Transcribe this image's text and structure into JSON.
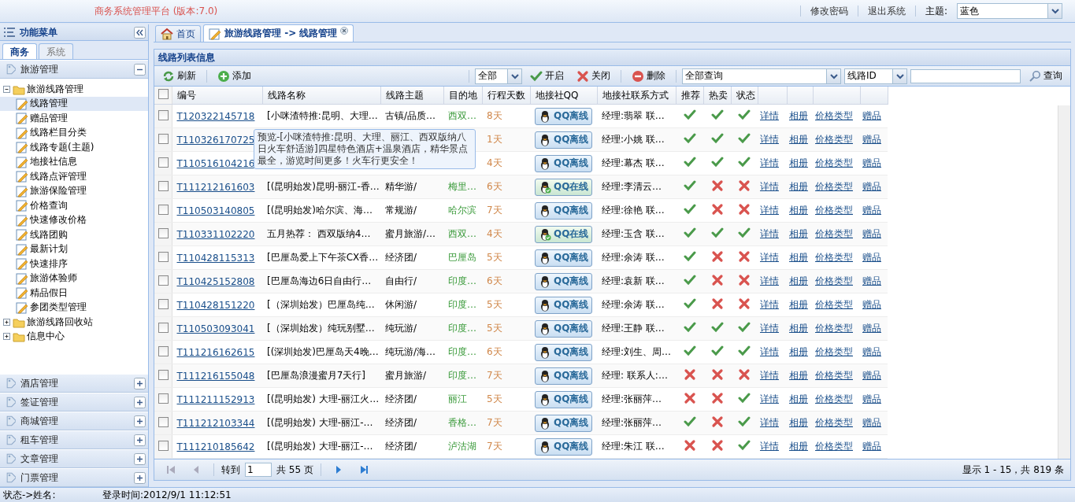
{
  "header": {
    "title": "商务系统管理平台 (版本:7.0)",
    "links": [
      "修改密码",
      "退出系统"
    ],
    "theme_label": "主题:",
    "theme_value": "蓝色"
  },
  "sidebar": {
    "title": "功能菜单",
    "tabs": [
      {
        "label": "商务",
        "selected": true
      },
      {
        "label": "系统",
        "selected": false
      }
    ],
    "sections": [
      {
        "label": "旅游管理",
        "expanded": true,
        "tree": [
          {
            "label": "旅游线路管理",
            "expanded": true,
            "children": [
              {
                "label": "线路管理",
                "selected": true
              },
              {
                "label": "赠品管理",
                "selected": false
              },
              {
                "label": "线路栏目分类",
                "selected": false
              },
              {
                "label": "线路专题(主题)",
                "selected": false
              },
              {
                "label": "地接社信息",
                "selected": false
              },
              {
                "label": "线路点评管理",
                "selected": false
              },
              {
                "label": "旅游保险管理",
                "selected": false
              },
              {
                "label": "价格查询",
                "selected": false
              },
              {
                "label": "快速修改价格",
                "selected": false
              },
              {
                "label": "线路团购",
                "selected": false
              },
              {
                "label": "最新计划",
                "selected": false
              },
              {
                "label": "快速排序",
                "selected": false
              },
              {
                "label": "旅游体验师",
                "selected": false
              },
              {
                "label": "精品假日",
                "selected": false
              },
              {
                "label": "参团类型管理",
                "selected": false
              }
            ]
          },
          {
            "label": "旅游线路回收站",
            "expanded": false
          },
          {
            "label": "信息中心",
            "expanded": false
          }
        ]
      },
      {
        "label": "酒店管理",
        "expanded": false
      },
      {
        "label": "签证管理",
        "expanded": false
      },
      {
        "label": "商城管理",
        "expanded": false
      },
      {
        "label": "租车管理",
        "expanded": false
      },
      {
        "label": "文章管理",
        "expanded": false
      },
      {
        "label": "门票管理",
        "expanded": false
      }
    ]
  },
  "tabs": [
    {
      "label": "首页",
      "kind": "home",
      "selected": false
    },
    {
      "label": "旅游线路管理 -> 线路管理",
      "kind": "page",
      "selected": true
    }
  ],
  "panel": {
    "title": "线路列表信息",
    "toolbar": {
      "refresh": "刷新",
      "add": "添加",
      "filter": "全部",
      "enable": "开启",
      "disable": "关闭",
      "delete": "删除",
      "query_type": "全部查询",
      "field": "线路ID",
      "search": "查询"
    },
    "all_checked": false,
    "columns": [
      "编号",
      "线路名称",
      "线路主题",
      "目的地",
      "行程天数",
      "地接社QQ",
      "地接社联系方式",
      "推荐",
      "热卖",
      "状态"
    ],
    "rows": [
      {
        "checked": false,
        "id": "T120322145718",
        "name": "[小咪渣特推:昆明、大理…",
        "theme": "古镇/品质…",
        "destination": "西双…",
        "days": "8天",
        "qq": "QQ离线",
        "qq_online": false,
        "contact": "经理:翡翠 联…",
        "recommended": true,
        "hot": true,
        "status": true,
        "links": [
          "详情",
          "相册",
          "价格类型",
          "赠品"
        ]
      },
      {
        "checked": false,
        "id": "T110326170725",
        "days": "1天",
        "qq": "QQ离线",
        "qq_online": false,
        "contact": "经理:小姚 联…",
        "recommended": true,
        "hot": true,
        "status": true,
        "links": [
          "详情",
          "相册",
          "价格类型",
          "赠品"
        ]
      },
      {
        "checked": false,
        "id": "T110516104216",
        "days": "4天",
        "qq": "QQ离线",
        "qq_online": false,
        "contact": "经理:幕杰 联…",
        "recommended": true,
        "hot": true,
        "status": true,
        "links": [
          "详情",
          "相册",
          "价格类型",
          "赠品"
        ]
      },
      {
        "checked": false,
        "id": "T111212161603",
        "name": "[(昆明始发)昆明-丽江-香…",
        "theme": "精华游/",
        "destination": "梅里…",
        "days": "6天",
        "qq": "QQ在线",
        "qq_online": true,
        "contact": "经理:李清云…",
        "recommended": true,
        "hot": false,
        "status": false,
        "links": [
          "详情",
          "相册",
          "价格类型",
          "赠品"
        ]
      },
      {
        "checked": false,
        "id": "T110503140805",
        "name": "[(昆明始发)哈尔滨、海…",
        "theme": "常规游/",
        "destination": "哈尔滨",
        "days": "7天",
        "qq": "QQ离线",
        "qq_online": false,
        "contact": "经理:徐艳 联…",
        "recommended": true,
        "hot": false,
        "status": false,
        "links": [
          "详情",
          "相册",
          "价格类型",
          "赠品"
        ]
      },
      {
        "checked": false,
        "id": "T110331102220",
        "name": "五月热荐： 西双版纳4…",
        "theme": "蜜月旅游/…",
        "destination": "西双…",
        "days": "4天",
        "qq": "QQ在线",
        "qq_online": true,
        "contact": "经理:玉含 联…",
        "recommended": true,
        "hot": true,
        "status": true,
        "links": [
          "详情",
          "相册",
          "价格类型",
          "赠品"
        ]
      },
      {
        "checked": false,
        "id": "T110428115313",
        "name": "[巴厘岛爱上下午茶CX香…",
        "theme": "经济团/",
        "destination": "巴厘岛",
        "days": "5天",
        "qq": "QQ离线",
        "qq_online": false,
        "contact": "经理:余涛 联…",
        "recommended": true,
        "hot": false,
        "status": false,
        "links": [
          "详情",
          "相册",
          "价格类型",
          "赠品"
        ]
      },
      {
        "checked": false,
        "id": "T110425152808",
        "name": "[巴厘岛海边6日自由行…",
        "theme": "自由行/",
        "destination": "印度…",
        "days": "6天",
        "qq": "QQ离线",
        "qq_online": false,
        "contact": "经理:袁新 联…",
        "recommended": true,
        "hot": false,
        "status": false,
        "links": [
          "详情",
          "相册",
          "价格类型",
          "赠品"
        ]
      },
      {
        "checked": false,
        "id": "T110428151220",
        "name": "[（深圳始发）巴厘岛纯…",
        "theme": "休闲游/",
        "destination": "印度…",
        "days": "5天",
        "qq": "QQ离线",
        "qq_online": false,
        "contact": "经理:余涛 联…",
        "recommended": true,
        "hot": false,
        "status": false,
        "links": [
          "详情",
          "相册",
          "价格类型",
          "赠品"
        ]
      },
      {
        "checked": false,
        "id": "T110503093041",
        "name": "[（深圳始发）纯玩别墅…",
        "theme": "纯玩游/",
        "destination": "印度…",
        "days": "5天",
        "qq": "QQ离线",
        "qq_online": false,
        "contact": "经理:王静 联…",
        "recommended": true,
        "hot": true,
        "status": true,
        "links": [
          "详情",
          "相册",
          "价格类型",
          "赠品"
        ]
      },
      {
        "checked": false,
        "id": "T111216162615",
        "name": "[(深圳始发)巴厘岛天4晚…",
        "theme": "纯玩游/海…",
        "destination": "印度…",
        "days": "6天",
        "qq": "QQ离线",
        "qq_online": false,
        "contact": "经理:刘生、周…",
        "recommended": true,
        "hot": true,
        "status": true,
        "links": [
          "详情",
          "相册",
          "价格类型",
          "赠品"
        ]
      },
      {
        "checked": false,
        "id": "T111216155048",
        "name": "[巴厘岛浪漫蜜月7天行]",
        "theme": "蜜月旅游/",
        "destination": "印度…",
        "days": "7天",
        "qq": "QQ离线",
        "qq_online": false,
        "contact": "经理: 联系人:…",
        "recommended": false,
        "hot": false,
        "status": false,
        "links": [
          "详情",
          "相册",
          "价格类型",
          "赠品"
        ]
      },
      {
        "checked": false,
        "id": "T111211152913",
        "name": "[(昆明始发) 大理-丽江火…",
        "theme": "经济团/",
        "destination": "丽江",
        "days": "5天",
        "qq": "QQ离线",
        "qq_online": false,
        "contact": "经理:张丽萍…",
        "recommended": false,
        "hot": false,
        "status": true,
        "links": [
          "详情",
          "相册",
          "价格类型",
          "赠品"
        ]
      },
      {
        "checked": false,
        "id": "T111212103344",
        "name": "[(昆明始发) 大理-丽江-…",
        "theme": "经济团/",
        "destination": "香格…",
        "days": "7天",
        "qq": "QQ离线",
        "qq_online": false,
        "contact": "经理:张丽萍…",
        "recommended": true,
        "hot": false,
        "status": true,
        "links": [
          "详情",
          "相册",
          "价格类型",
          "赠品"
        ]
      },
      {
        "checked": false,
        "id": "T111210185642",
        "name": "[(昆明始发) 大理-丽江-…",
        "theme": "经济团/",
        "destination": "泸沽湖",
        "days": "7天",
        "qq": "QQ离线",
        "qq_online": false,
        "contact": "经理:朱江 联…",
        "recommended": false,
        "hot": false,
        "status": true,
        "links": [
          "详情",
          "相册",
          "价格类型",
          "赠品"
        ]
      }
    ],
    "tooltip": "预览-[小咪渣特推:昆明、大理、丽江、西双版纳八日火车舒适游]四星特色酒店+温泉酒店，精华景点最全，游览时间更多！火车行更安全！",
    "pager": {
      "goto": "转到",
      "page": "1",
      "total": "共 55 页",
      "summary": "显示 1 - 15，共 819 条"
    }
  },
  "status_bar": {
    "user": "状态->姓名:",
    "login_time": "登录时间:2012/9/1 11:12:51"
  }
}
